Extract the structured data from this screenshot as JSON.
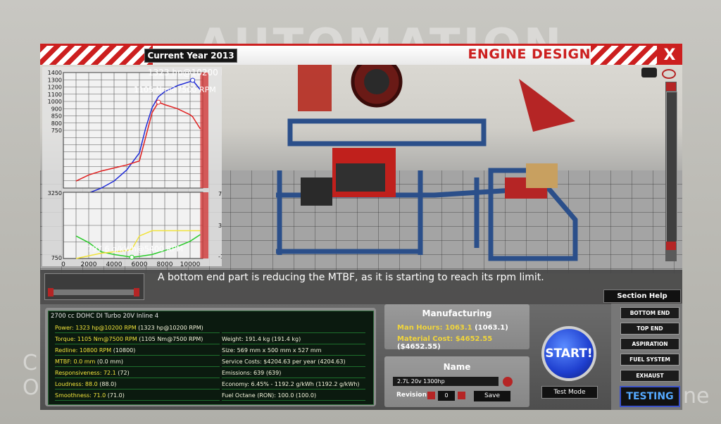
{
  "window": {
    "title": "ENGINE DESIGN",
    "current_year": "Current Year 2013",
    "close_label": "X"
  },
  "chart_data": [
    {
      "type": "line",
      "title": "",
      "x": [
        1000,
        2000,
        3000,
        4000,
        5000,
        6000,
        6500,
        7000,
        7500,
        8000,
        9000,
        10000,
        10200,
        10800
      ],
      "ylim": [
        0,
        1400
      ],
      "yticks": [
        0,
        50,
        100,
        150,
        200,
        250,
        300,
        350,
        400,
        450,
        500,
        550,
        600,
        650,
        700,
        750,
        800,
        850,
        900,
        950,
        1000,
        1050,
        1100,
        1150,
        1200,
        1250,
        1300,
        1350,
        1400
      ],
      "ytick_labels": [
        "1400",
        "1300",
        "1200",
        "1100",
        "1000",
        "900",
        "850",
        "800",
        "750"
      ],
      "series": [
        {
          "name": "power",
          "color": "#1f2bd6",
          "values": [
            160,
            200,
            250,
            320,
            430,
            600,
            850,
            1050,
            1160,
            1210,
            1270,
            1310,
            1323,
            1230
          ]
        },
        {
          "name": "torque",
          "color": "#e02020",
          "values": [
            320,
            380,
            420,
            450,
            480,
            520,
            760,
            1000,
            1105,
            1080,
            1040,
            980,
            960,
            840
          ]
        }
      ],
      "annotations": [
        "1323 hp@10200 RPM",
        "1105 Nm@7500 RPM"
      ],
      "redline_rpm": 10800
    },
    {
      "type": "line",
      "title": "",
      "x": [
        1000,
        2000,
        3000,
        4000,
        5000,
        5400,
        6000,
        7000,
        8000,
        9000,
        10000,
        10800
      ],
      "xtick_labels": [
        "0",
        "2000",
        "4000",
        "6000",
        "8000",
        "10000"
      ],
      "left_ylim": [
        750,
        3250
      ],
      "left_ytick_labels": [
        "3250",
        "750"
      ],
      "right_ytick_labels": [
        "7.0",
        "3.0",
        "-1.0"
      ],
      "series": [
        {
          "name": "efficiency",
          "color": "#2acb2a",
          "values": [
            1600,
            1350,
            1000,
            900,
            830,
            797.6,
            830,
            900,
            1050,
            1200,
            1400,
            1650
          ]
        },
        {
          "name": "boost",
          "color": "#f1e33a",
          "values": [
            750,
            850,
            950,
            1000,
            1050,
            1100,
            1600,
            1800,
            1800,
            1800,
            1800,
            1800
          ]
        }
      ],
      "annotations": [
        "797.6 g/kWh@5400 RPM"
      ]
    }
  ],
  "status_message": "A bottom end part is reducing the MTBF, as it is starting to reach its rpm limit.",
  "section_help_label": "Section Help",
  "stats": {
    "engine_name": "2700 cc DOHC DI Turbo 20V Inline 4",
    "left": [
      {
        "label": "Power: 1323 hp@10200 RPM",
        "value": " (1323 hp@10200 RPM)",
        "highlight": true
      },
      {
        "label": "Torque: 1105 Nm@7500 RPM",
        "value": " (1105 Nm@7500 RPM)",
        "highlight": true
      },
      {
        "label": "Redline: 10800 RPM",
        "value": " (10800)",
        "highlight": true
      },
      {
        "label": "MTBF: 0.0 mm",
        "value": " (0.0 mm)",
        "highlight": true
      },
      {
        "label": "Responsiveness: 72.1",
        "value": " (72)",
        "highlight": true
      },
      {
        "label": "Loudness: 88.0",
        "value": " (88.0)",
        "highlight": true
      },
      {
        "label": "Smoothness: 71.0",
        "value": " (71.0)",
        "highlight": true
      }
    ],
    "right": [
      {
        "label": "",
        "value": ""
      },
      {
        "label": "Weight: 191.4 kg",
        "value": " (191.4 kg)"
      },
      {
        "label": "Size: 569 mm x 500 mm x 527 mm",
        "value": ""
      },
      {
        "label": "Service Costs: $4204.63 per year",
        "value": " (4204.63)"
      },
      {
        "label": "Emissions: 639",
        "value": " (639)"
      },
      {
        "label": "Economy: 6.45% - 1192.2 g/kWh",
        "value": " (1192.2 g/kWh)"
      },
      {
        "label": "Fuel Octane (RON): 100.0",
        "value": " (100.0)"
      }
    ]
  },
  "manufacturing": {
    "title": "Manufacturing",
    "man_hours_label": "Man Hours: 1063.1",
    "man_hours_value": " (1063.1)",
    "material_cost_label": "Material Cost: $4652.55",
    "material_cost_value": " ($4652.55)"
  },
  "name_panel": {
    "title": "Name",
    "name_value": "2.7L 20v 1300hp",
    "revision_label": "Revision",
    "revision_value": "0",
    "save_label": "Save"
  },
  "start_label": "START!",
  "test_mode_label": "Test Mode",
  "sections": [
    "BOTTOM END",
    "TOP END",
    "ASPIRATION",
    "FUEL SYSTEM",
    "EXHAUST"
  ],
  "testing_label": "TESTING",
  "colors": {
    "accent_red": "#cc1f1f",
    "highlight_yellow": "#f1e33a",
    "start_blue": "#1f3fcf"
  }
}
